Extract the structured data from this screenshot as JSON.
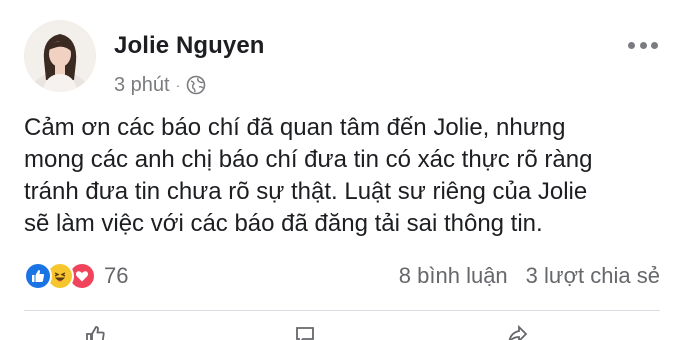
{
  "post": {
    "author": "Jolie Nguyen",
    "time": "3 phút",
    "separator": "·",
    "privacy_icon": "globe-icon",
    "more_icon": "more-options-icon",
    "body_lines": [
      "Cảm ơn các báo chí đã quan tâm đến Jolie, nhưng",
      "mong các anh chị báo chí đưa tin có xác thực rõ ràng",
      "tránh đưa tin chưa rõ sự thật. Luật sư riêng của Jolie",
      "sẽ làm việc với các báo đã đăng tải sai thông tin."
    ]
  },
  "stats": {
    "reactions": [
      "like",
      "haha",
      "love"
    ],
    "reaction_count": "76",
    "comments": "8 bình luận",
    "shares": "3 lượt chia sẻ"
  },
  "actions": {
    "items": [
      {
        "icon": "like-icon"
      },
      {
        "icon": "comment-icon"
      },
      {
        "icon": "share-icon"
      }
    ]
  },
  "colors": {
    "like": "#1b74e4",
    "haha": "#f7c62f",
    "love": "#f0445d",
    "secondary_text": "#65676b"
  }
}
